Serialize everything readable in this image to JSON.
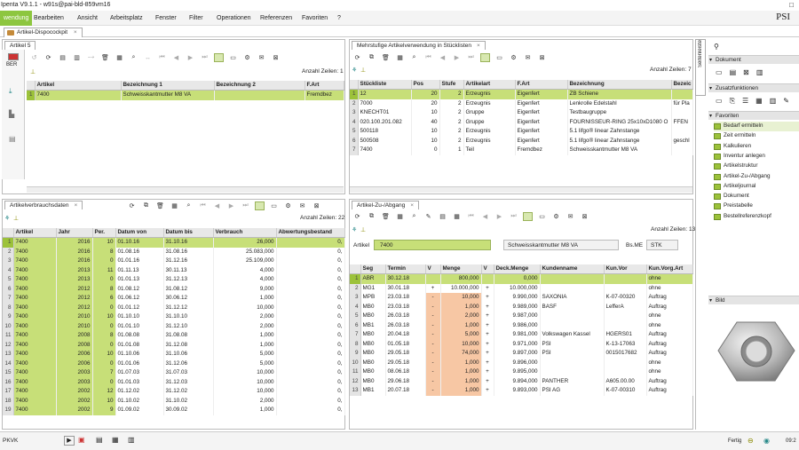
{
  "window": {
    "title": "Ipenta V9.1.1 - w91s@pai-bld-859vm16",
    "controls": "□"
  },
  "brand": {
    "logo": "PSI"
  },
  "menu": [
    "wendung",
    "Bearbeiten",
    "Ansicht",
    "Arbeitsplatz",
    "Fenster",
    "Filter",
    "Operationen",
    "Referenzen",
    "Favoriten",
    "?"
  ],
  "doctab": {
    "label": "Artikel-Dispocockpit"
  },
  "artikel_panel": {
    "tab": "Artikel 5",
    "flag_label": "BER",
    "count": "Anzahl Zeilen: 1",
    "columns": [
      "Artikel",
      "Bezeichnung 1",
      "Bezeichnung 2",
      "F.Art"
    ],
    "rows": [
      [
        "1",
        "7400",
        "Schweisskantmutter M8 VA",
        "",
        "Fremdbez"
      ]
    ]
  },
  "stueckliste_panel": {
    "tab": "Mehrstufige Artikelverwendung in Stücklisten",
    "count": "Anzahl Zeilen: 7",
    "columns": [
      "Stückliste",
      "Pos",
      "Stufe",
      "Artikelart",
      "F.Art",
      "Bezeichnung",
      "Bezeic"
    ],
    "rows": [
      [
        "1",
        "12",
        "20",
        "2",
        "Erzeugnis",
        "Eigenfert",
        "ZB Schiene",
        ""
      ],
      [
        "2",
        "7000",
        "20",
        "2",
        "Erzeugnis",
        "Eigenfert",
        "Lenkrolle Edelstahl",
        "für Pla"
      ],
      [
        "3",
        "KNECHT01",
        "10",
        "2",
        "Gruppe",
        "Eigenfert",
        "Testbaugruppe",
        ""
      ],
      [
        "4",
        "020.100.201.082",
        "40",
        "2",
        "Gruppe",
        "Eigenfert",
        "FOURNISSEUR-RING 25x10xD1080 O",
        "FFEN"
      ],
      [
        "5",
        "500118",
        "10",
        "2",
        "Erzeugnis",
        "Eigenfert",
        "5.1 lifgo® linear Zahnstange",
        ""
      ],
      [
        "6",
        "500508",
        "10",
        "2",
        "Erzeugnis",
        "Eigenfert",
        "5.1 lifgo® linear Zahnstange",
        "geschl"
      ],
      [
        "7",
        "7400",
        "0",
        "1",
        "Teil",
        "Fremdbez",
        "Schweisskantmutter M8 VA",
        ""
      ]
    ]
  },
  "verbrauch_panel": {
    "tab": "Artikelverbrauchsdaten",
    "count": "Anzahl Zeilen: 22",
    "columns": [
      "Artikel",
      "Jahr",
      "Per.",
      "Datum von",
      "Datum bis",
      "Verbrauch",
      "Abwertungsbestand"
    ],
    "rows": [
      [
        "1",
        "7400",
        "2016",
        "10",
        "01.10.16",
        "31.10.16",
        "26,000",
        "0,"
      ],
      [
        "2",
        "7400",
        "2016",
        "8",
        "01.08.16",
        "31.08.16",
        "25.083,000",
        "0,"
      ],
      [
        "3",
        "7400",
        "2016",
        "0",
        "01.01.16",
        "31.12.16",
        "25.109,000",
        "0,"
      ],
      [
        "4",
        "7400",
        "2013",
        "11",
        "01.11.13",
        "30.11.13",
        "4,000",
        "0,"
      ],
      [
        "5",
        "7400",
        "2013",
        "0",
        "01.01.13",
        "31.12.13",
        "4,000",
        "0,"
      ],
      [
        "6",
        "7400",
        "2012",
        "8",
        "01.08.12",
        "31.08.12",
        "9,000",
        "0,"
      ],
      [
        "7",
        "7400",
        "2012",
        "6",
        "01.06.12",
        "30.06.12",
        "1,000",
        "0,"
      ],
      [
        "8",
        "7400",
        "2012",
        "0",
        "01.01.12",
        "31.12.12",
        "10,000",
        "0,"
      ],
      [
        "9",
        "7400",
        "2010",
        "10",
        "01.10.10",
        "31.10.10",
        "2,000",
        "0,"
      ],
      [
        "10",
        "7400",
        "2010",
        "0",
        "01.01.10",
        "31.12.10",
        "2,000",
        "0,"
      ],
      [
        "11",
        "7400",
        "2008",
        "8",
        "01.08.08",
        "31.08.08",
        "1,000",
        "0,"
      ],
      [
        "12",
        "7400",
        "2008",
        "0",
        "01.01.08",
        "31.12.08",
        "1,000",
        "0,"
      ],
      [
        "13",
        "7400",
        "2006",
        "10",
        "01.10.06",
        "31.10.06",
        "5,000",
        "0,"
      ],
      [
        "14",
        "7400",
        "2006",
        "0",
        "01.01.06",
        "31.12.06",
        "5,000",
        "0,"
      ],
      [
        "15",
        "7400",
        "2003",
        "7",
        "01.07.03",
        "31.07.03",
        "10,000",
        "0,"
      ],
      [
        "16",
        "7400",
        "2003",
        "0",
        "01.01.03",
        "31.12.03",
        "10,000",
        "0,"
      ],
      [
        "17",
        "7400",
        "2002",
        "12",
        "01.12.02",
        "31.12.02",
        "10,000",
        "0,"
      ],
      [
        "18",
        "7400",
        "2002",
        "10",
        "01.10.02",
        "31.10.02",
        "2,000",
        "0,"
      ],
      [
        "19",
        "7400",
        "2002",
        "9",
        "01.09.02",
        "30.09.02",
        "1,000",
        "0,"
      ]
    ]
  },
  "zuabgang_panel": {
    "tab": "Artikel-Zu-/Abgang",
    "count": "Anzahl Zeilen: 13",
    "artikel_label": "Artikel",
    "artikel_value": "7400",
    "bez_value": "Schweisskantmutter M8 VA",
    "bsme_label": "Bs.ME",
    "bsme_value": "STK",
    "columns": [
      "Seg",
      "Termin",
      "V",
      "Menge",
      "V",
      "Deck.Menge",
      "Kundenname",
      "Kun.Vor",
      "Kun.Vorg.Art"
    ],
    "rows": [
      [
        "1",
        "ABR",
        "30.12.18",
        "",
        "800,000",
        "",
        "0,000",
        "",
        "",
        "ohne"
      ],
      [
        "2",
        "MG1",
        "30.01.18",
        "+",
        "10.000,000",
        "+",
        "10.000,000",
        "",
        "",
        "ohne"
      ],
      [
        "3",
        "MPB",
        "23.03.18",
        "-",
        "10,000",
        "+",
        "9.990,000",
        "SAXONIA",
        "K-07-00320",
        "Auftrag"
      ],
      [
        "4",
        "MB0",
        "23.03.18",
        "-",
        "1,000",
        "+",
        "9.989,000",
        "BASF",
        "LefferA",
        "Auftrag"
      ],
      [
        "5",
        "MB0",
        "26.03.18",
        "-",
        "2,000",
        "+",
        "9.987,000",
        "",
        "",
        "ohne"
      ],
      [
        "6",
        "MB1",
        "26.03.18",
        "-",
        "1,000",
        "+",
        "9.986,000",
        "",
        "",
        "ohne"
      ],
      [
        "7",
        "MB0",
        "20.04.18",
        "-",
        "5,000",
        "+",
        "9.981,000",
        "Volkswagen Kassel",
        "HGERS01",
        "Auftrag"
      ],
      [
        "8",
        "MB0",
        "01.05.18",
        "-",
        "10,000",
        "+",
        "9.971,000",
        "PSI",
        "K-13-17063",
        "Auftrag"
      ],
      [
        "9",
        "MB0",
        "29.05.18",
        "-",
        "74,000",
        "+",
        "9.897,000",
        "PSI",
        "0015017682",
        "Auftrag"
      ],
      [
        "10",
        "MB0",
        "29.05.18",
        "-",
        "1,000",
        "+",
        "9.896,000",
        "",
        "",
        "ohne"
      ],
      [
        "11",
        "MB0",
        "08.06.18",
        "-",
        "1,000",
        "+",
        "9.895,000",
        "",
        "",
        "ohne"
      ],
      [
        "12",
        "MB0",
        "29.06.18",
        "-",
        "1,000",
        "+",
        "9.894,000",
        "PANTHER",
        "A605.00.00",
        "Auftrag"
      ],
      [
        "13",
        "MB1",
        "20.07.18",
        "-",
        "1,000",
        "+",
        "9.893,000",
        "PSI AG",
        "K-07-00310",
        "Auftrag"
      ]
    ]
  },
  "sidebar": {
    "vtab": "Seitenleiste",
    "dokument": "Dokument",
    "zusatz": "Zusatzfunktionen",
    "favoriten": "Favoriten",
    "favs": [
      "Bedarf ermitteln",
      "Zeit ermitteln",
      "Kalkulieren",
      "Inventur anlegen",
      "Artikelstruktur",
      "Artikel-Zu-/Abgang",
      "Artikeljournal",
      "Dokument",
      "Preistabelle",
      "Bestellreferenzkopf"
    ],
    "bild": "Bild"
  },
  "status": {
    "field": "PKVK",
    "state": "Fertig",
    "time": "09:2"
  }
}
